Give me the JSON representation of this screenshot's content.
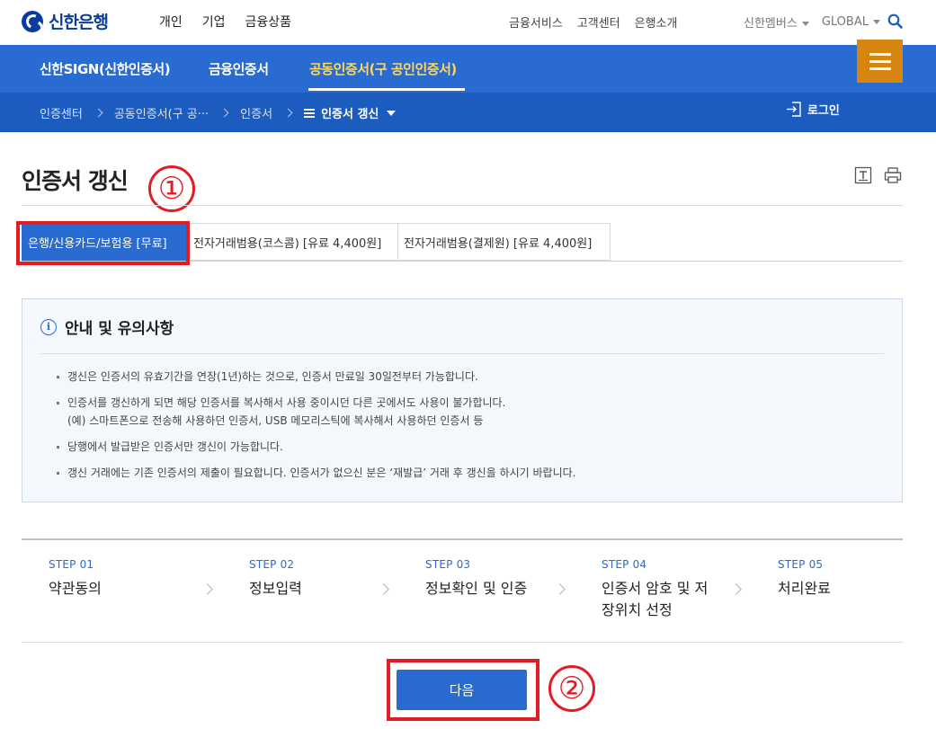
{
  "header": {
    "logo_text": "신한은행",
    "main_nav": [
      "개인",
      "기업",
      "금융상품"
    ],
    "util_nav": [
      "금융서비스",
      "고객센터",
      "은행소개"
    ],
    "members": "신한멤버스",
    "global": "GLOBAL"
  },
  "tabs": {
    "items": [
      "신한SIGN(신한인증서)",
      "금융인증서",
      "공동인증서(구 공인인증서)"
    ],
    "active_index": 2
  },
  "breadcrumb": {
    "items": [
      "인증센터",
      "공동인증서(구 공···",
      "인증서"
    ],
    "current": "인증서 갱신",
    "login": "로그인"
  },
  "page": {
    "title": "인증서 갱신"
  },
  "subtabs": {
    "items": [
      "은행/신용카드/보험용 [무료]",
      "전자거래범용(코스콤) [유료 4,400원]",
      "전자거래범용(결제원) [유료 4,400원]"
    ],
    "active_index": 0
  },
  "notice": {
    "title": "안내 및 유의사항",
    "items": [
      "갱신은 인증서의 유효기간을 연장(1년)하는 것으로, 인증서 만료일 30일전부터 가능합니다.",
      "인증서를 갱신하게 되면 해당 인증서를 복사해서 사용 중이시던 다른 곳에서도 사용이 불가합니다.",
      "(예) 스마트폰으로 전송해 사용하던 인증서, USB 메모리스틱에 복사해서 사용하던 인증서 등",
      "당행에서 발급받은 인증서만 갱신이 가능합니다.",
      "갱신 거래에는 기존 인증서의 제출이 필요합니다. 인증서가 없으신 분은 ‘재발급’ 거래 후 갱신을 하시기 바랍니다."
    ]
  },
  "steps": [
    {
      "num": "STEP 01",
      "label": "약관동의"
    },
    {
      "num": "STEP 02",
      "label": "정보입력"
    },
    {
      "num": "STEP 03",
      "label": "정보확인 및 인증"
    },
    {
      "num": "STEP 04",
      "label": "인증서 암호 및 저장위치 선정"
    },
    {
      "num": "STEP 05",
      "label": "처리완료"
    }
  ],
  "next_button": "다음",
  "annotations": [
    "①",
    "②"
  ],
  "colors": {
    "primary_blue": "#2a6bd1",
    "dark_blue": "#1d5cbf",
    "brand_navy": "#0a3d9a",
    "menu_orange": "#d6850f",
    "active_tab_text": "#ffd85a",
    "annotation_red": "#e31c23"
  }
}
